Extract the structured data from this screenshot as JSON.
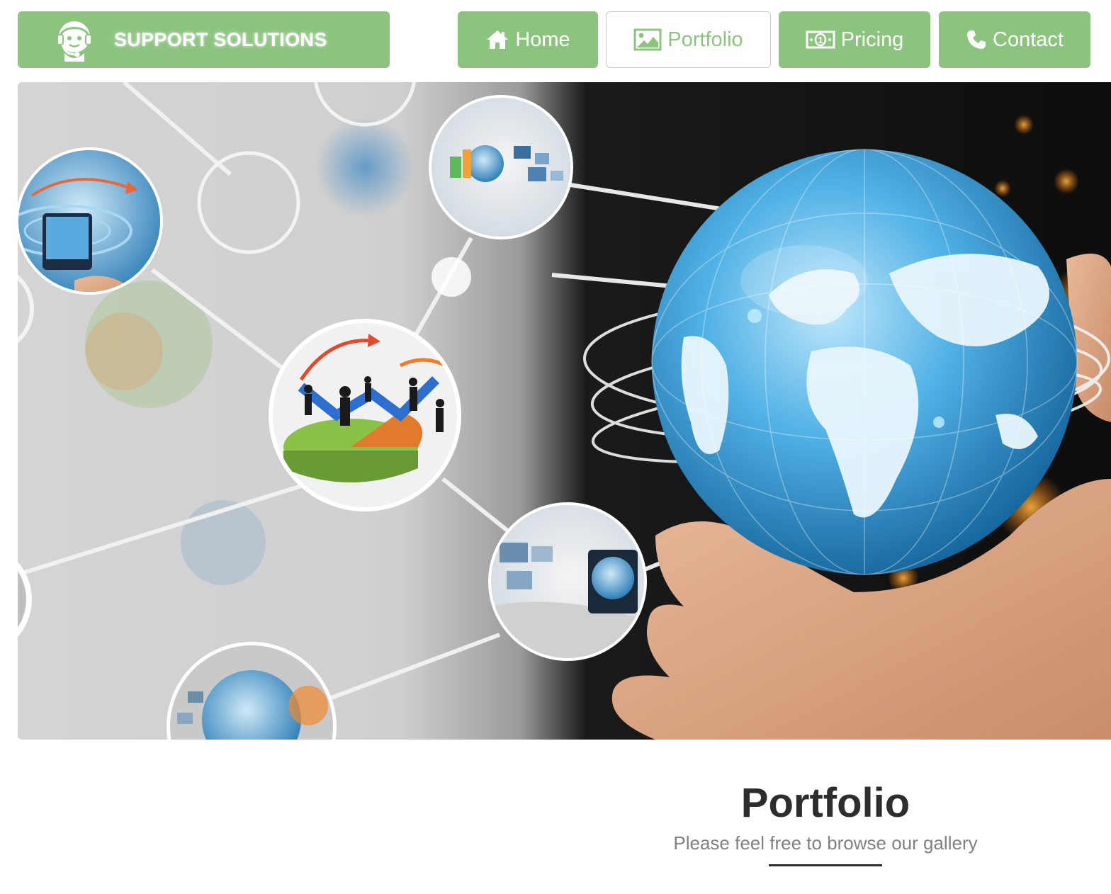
{
  "brand": {
    "name": "SUPPORT SOLUTIONS",
    "logo_icon": "headset-support-icon"
  },
  "nav": {
    "items": [
      {
        "label": "Home",
        "icon": "home-icon",
        "active": false
      },
      {
        "label": "Portfolio",
        "icon": "image-icon",
        "active": true
      },
      {
        "label": "Pricing",
        "icon": "money-icon",
        "active": false
      },
      {
        "label": "Contact",
        "icon": "phone-icon",
        "active": false
      }
    ]
  },
  "hero": {
    "image": "network-globe-hand-banner"
  },
  "section": {
    "title": "Portfolio",
    "subtitle": "Please feel free to browse our gallery"
  },
  "colors": {
    "accent": "#8cc47f",
    "heading": "#2d2d2d",
    "muted": "#808080",
    "white": "#ffffff"
  }
}
